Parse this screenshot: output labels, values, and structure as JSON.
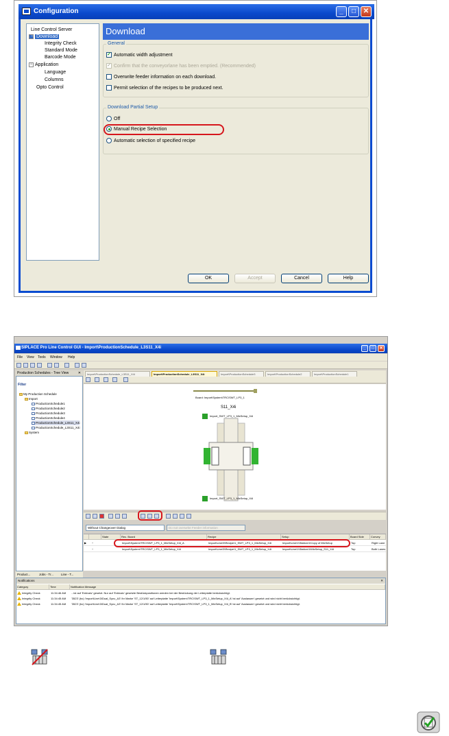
{
  "config_dialog": {
    "title": "Configuration",
    "tree": [
      {
        "label": "Line Control Server",
        "expander": "",
        "indent": 0
      },
      {
        "label": "Download",
        "expander": "−",
        "indent": 0,
        "selected": true
      },
      {
        "label": "Integrity Check",
        "expander": "",
        "indent": 1
      },
      {
        "label": "Standard Mode",
        "expander": "",
        "indent": 1
      },
      {
        "label": "Barcode Mode",
        "expander": "",
        "indent": 1
      },
      {
        "label": "Application",
        "expander": "−",
        "indent": 0
      },
      {
        "label": "Language",
        "expander": "",
        "indent": 1
      },
      {
        "label": "Columns",
        "expander": "",
        "indent": 1
      },
      {
        "label": "Opto Control",
        "expander": "",
        "indent": 0
      }
    ],
    "header": "Download",
    "general": {
      "title": "General",
      "options": [
        {
          "label": "Automatic width adjustment",
          "checked": true,
          "enabled": true
        },
        {
          "label": "Confirm that the conveyorlane has been emptied. (Recommended)",
          "checked": true,
          "enabled": false
        },
        {
          "label": "Overwrite feeder information on each download.",
          "checked": false,
          "enabled": true
        },
        {
          "label": "Permit selection of the recipes to be produced next.",
          "checked": false,
          "enabled": true
        }
      ]
    },
    "partial": {
      "title": "Download Partial Setup",
      "options": [
        {
          "label": "Off",
          "selected": false
        },
        {
          "label": "Manual Recipe Selection",
          "selected": true
        },
        {
          "label": "Automatic selection of specified recipe",
          "selected": false
        }
      ]
    },
    "buttons": {
      "ok": "OK",
      "accept": "Accept",
      "cancel": "Cancel",
      "help": "Help"
    }
  },
  "lc_app": {
    "title": "SIPLACE Pro Line Control GUI - Import\\ProductionSchedule_L3S11_X4i",
    "menu": [
      "File",
      "View",
      "Tools",
      "Window",
      "Help"
    ],
    "left_pane": {
      "header": "Production Schedules - Tree View",
      "filter_label": "Filter",
      "tree": [
        {
          "label": "My Production Schedule",
          "indent": 0,
          "kind": "folder"
        },
        {
          "label": "Import",
          "indent": 1,
          "kind": "folder"
        },
        {
          "label": "ProductionSchedule1",
          "indent": 2,
          "kind": "sched"
        },
        {
          "label": "ProductionSchedule2",
          "indent": 2,
          "kind": "sched"
        },
        {
          "label": "ProductionSchedule3",
          "indent": 2,
          "kind": "sched"
        },
        {
          "label": "ProductionSchedule4",
          "indent": 2,
          "kind": "sched"
        },
        {
          "label": "ProductionSchedule_L3S11_X4i",
          "indent": 2,
          "kind": "sched",
          "selected": true
        },
        {
          "label": "ProductionSchedule_L3S11_X4i",
          "indent": 2,
          "kind": "sched"
        },
        {
          "label": "System",
          "indent": 1,
          "kind": "folder"
        }
      ],
      "bottom_tabs": [
        "Product...",
        "Jobs - Tr...",
        "Line - T..."
      ]
    },
    "doc_tabs": [
      {
        "label": "Import\\ProductionSchedule_L3S11_X4i",
        "active": false
      },
      {
        "label": "Import\\ProductionSchedule_L3S11_X4i",
        "active": true
      },
      {
        "label": "Import\\ProductionSchedule3",
        "active": false
      },
      {
        "label": "Import\\ProductionSchedule2",
        "active": false
      },
      {
        "label": "Import\\ProductionSchedule1",
        "active": false
      }
    ],
    "canvas": {
      "board_label": "Board: Import\\System\\TRC\\SWT_LP3_1",
      "station_label": "S11_X4i",
      "setup_top": "Import_SWT_LP3_1_MixSetup_X4i",
      "setup_bottom": "Import_SWT_LP3_1_MixSetup_X4i"
    },
    "combo_left": "Without Changeover Dialog",
    "combo_right": "Do not overwrite Feeder information",
    "grid": {
      "columns": [
        "",
        "",
        "State",
        "Rec. Board",
        "Recipe",
        "Setup",
        "Board Side",
        "Convey"
      ],
      "rows": [
        [
          "▶",
          "−",
          "",
          "Import\\System\\TRC\\SWT_LP3_1_MixSetup_X4i_A",
          "Import\\Line\\3\\Recipe\\1_SWT_LP3_1_MixSetup_X4i",
          "Import\\Line\\1\\Station\\1\\Copy of MixSetup",
          "Top",
          "Right Lane"
        ],
        [
          "",
          "−",
          "",
          "Import\\System\\TRC\\SWT_LP3_1_MixSetup_X4i",
          "Import\\Line\\3\\Recipe\\1_SWT_LP3_1_MixSetup_X4i",
          "Import\\Line\\1\\Station\\1\\MixSetup_S11_X4i",
          "Top",
          "Both Lanes"
        ]
      ]
    },
    "notifications": {
      "header": "Notifications",
      "columns": [
        "Category",
        "Time",
        "Notification Message"
      ],
      "rows": [
        [
          "Integrity Check",
          "11:34:46 AM",
          "...ist auf 'Exklusiv' gesetzt. Nur auf 'Exklusiv' gesetzte Bestückpositionen werden bei der Bestückung der Leiterplatte berücksichtigt."
        ],
        [
          "Integrity Check",
          "11:34:45 AM",
          "'3523' (bo) 'Import\\Line\\3\\Dual_Sync_A3' Ihr Marke 'ST_12/1/50' auf Leiterplatte 'Import\\System\\TRC\\SWT_LP3_1_MixSetup_X4i_A' ist auf 'Auslassen' gesetzt und wird nicht berücksichtigt."
        ],
        [
          "Integrity Check",
          "11:34:45 AM",
          "'3523' (bo) 'Import\\Line\\3\\Dual_Sync_A3' Ihr Marke 'ST_12/1/50' auf Leiterplatte 'Import\\System\\TRC\\SWT_LP3_1_MixSetup_X4i_B' ist auf 'Auslassen' gesetzt und wird nicht berücksichtigt."
        ]
      ]
    }
  },
  "colors": {
    "accent": "#0a49cc",
    "highlight": "#d6161c",
    "check": "#21a121",
    "feeder_green": "#32b432"
  }
}
